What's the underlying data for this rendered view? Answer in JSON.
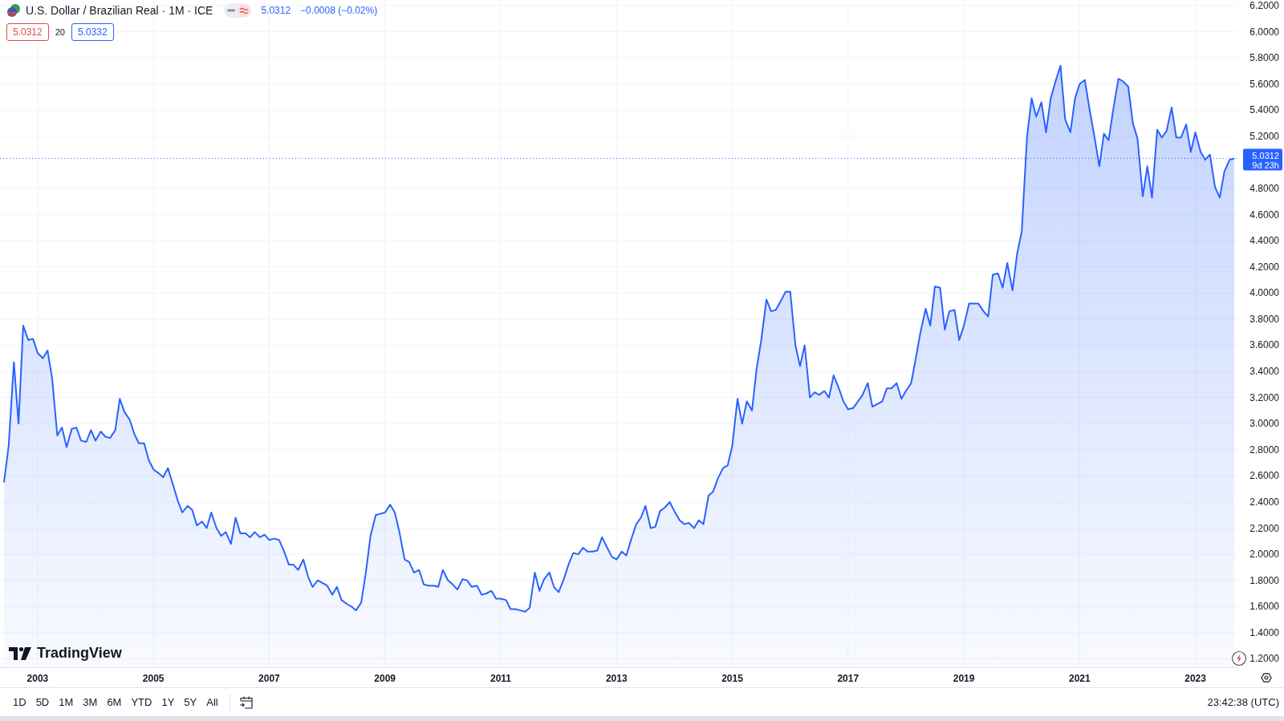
{
  "legend": {
    "title": "U.S. Dollar / Brazilian Real · 1M · ICE",
    "last": "5.0312",
    "change": "−0.0008 (−0.02%)",
    "bid": "5.0312",
    "spread": "20",
    "ask": "5.0332",
    "compare_toggle": {
      "on": true
    }
  },
  "chart": {
    "chart_data": {
      "type": "area",
      "x": [
        2002.42,
        2002.5,
        2002.59,
        2002.67,
        2002.75,
        2002.84,
        2002.92,
        2003,
        2003.09,
        2003.17,
        2003.25,
        2003.34,
        2003.42,
        2003.5,
        2003.59,
        2003.67,
        2003.75,
        2003.84,
        2003.92,
        2004,
        2004.09,
        2004.17,
        2004.25,
        2004.34,
        2004.42,
        2004.5,
        2004.59,
        2004.67,
        2004.75,
        2004.84,
        2004.92,
        2005,
        2005.09,
        2005.17,
        2005.25,
        2005.34,
        2005.42,
        2005.5,
        2005.59,
        2005.67,
        2005.75,
        2005.84,
        2005.92,
        2006,
        2006.09,
        2006.17,
        2006.25,
        2006.34,
        2006.42,
        2006.5,
        2006.59,
        2006.67,
        2006.75,
        2006.84,
        2006.92,
        2007,
        2007.09,
        2007.17,
        2007.25,
        2007.34,
        2007.42,
        2007.5,
        2007.59,
        2007.67,
        2007.75,
        2007.84,
        2007.92,
        2008,
        2008.09,
        2008.17,
        2008.25,
        2008.34,
        2008.42,
        2008.5,
        2008.59,
        2008.67,
        2008.75,
        2008.84,
        2008.92,
        2009,
        2009.09,
        2009.17,
        2009.25,
        2009.34,
        2009.42,
        2009.5,
        2009.59,
        2009.67,
        2009.75,
        2009.84,
        2009.92,
        2010,
        2010.09,
        2010.17,
        2010.25,
        2010.34,
        2010.42,
        2010.5,
        2010.59,
        2010.67,
        2010.75,
        2010.84,
        2010.92,
        2011,
        2011.09,
        2011.17,
        2011.25,
        2011.34,
        2011.42,
        2011.5,
        2011.59,
        2011.67,
        2011.75,
        2011.84,
        2011.92,
        2012,
        2012.09,
        2012.17,
        2012.25,
        2012.34,
        2012.42,
        2012.5,
        2012.59,
        2012.67,
        2012.75,
        2012.84,
        2012.92,
        2013,
        2013.09,
        2013.17,
        2013.25,
        2013.34,
        2013.42,
        2013.5,
        2013.59,
        2013.67,
        2013.75,
        2013.84,
        2013.92,
        2014,
        2014.09,
        2014.17,
        2014.25,
        2014.34,
        2014.42,
        2014.5,
        2014.59,
        2014.67,
        2014.75,
        2014.84,
        2014.92,
        2015,
        2015.09,
        2015.17,
        2015.25,
        2015.34,
        2015.42,
        2015.5,
        2015.59,
        2015.67,
        2015.75,
        2015.84,
        2015.92,
        2016,
        2016.09,
        2016.17,
        2016.25,
        2016.34,
        2016.42,
        2016.5,
        2016.59,
        2016.67,
        2016.75,
        2016.84,
        2016.92,
        2017,
        2017.09,
        2017.17,
        2017.25,
        2017.34,
        2017.42,
        2017.5,
        2017.59,
        2017.67,
        2017.75,
        2017.84,
        2017.92,
        2018,
        2018.09,
        2018.17,
        2018.25,
        2018.34,
        2018.42,
        2018.5,
        2018.59,
        2018.67,
        2018.75,
        2018.84,
        2018.92,
        2019,
        2019.09,
        2019.17,
        2019.25,
        2019.34,
        2019.42,
        2019.5,
        2019.59,
        2019.67,
        2019.75,
        2019.84,
        2019.92,
        2020,
        2020.09,
        2020.17,
        2020.25,
        2020.34,
        2020.42,
        2020.5,
        2020.59,
        2020.67,
        2020.75,
        2020.84,
        2020.92,
        2021,
        2021.09,
        2021.17,
        2021.25,
        2021.34,
        2021.42,
        2021.5,
        2021.59,
        2021.67,
        2021.75,
        2021.84,
        2021.92,
        2022,
        2022.09,
        2022.17,
        2022.25,
        2022.34,
        2022.42,
        2022.5,
        2022.59,
        2022.67,
        2022.75,
        2022.84,
        2022.92,
        2023,
        2023.09,
        2023.17,
        2023.25,
        2023.34,
        2023.42,
        2023.5,
        2023.59,
        2023.67
      ],
      "series": [
        {
          "color": "#2962ff",
          "values": [
            2.55,
            2.83,
            3.47,
            3.0,
            3.75,
            3.64,
            3.65,
            3.54,
            3.5,
            3.56,
            3.35,
            2.91,
            2.97,
            2.82,
            2.96,
            2.97,
            2.87,
            2.86,
            2.95,
            2.87,
            2.94,
            2.9,
            2.89,
            2.95,
            3.19,
            3.09,
            3.03,
            2.92,
            2.85,
            2.85,
            2.72,
            2.65,
            2.62,
            2.59,
            2.66,
            2.53,
            2.41,
            2.32,
            2.37,
            2.34,
            2.22,
            2.25,
            2.2,
            2.32,
            2.2,
            2.14,
            2.17,
            2.08,
            2.28,
            2.16,
            2.16,
            2.13,
            2.17,
            2.13,
            2.15,
            2.11,
            2.12,
            2.11,
            2.03,
            1.92,
            1.92,
            1.88,
            1.96,
            1.83,
            1.75,
            1.8,
            1.78,
            1.76,
            1.69,
            1.75,
            1.65,
            1.62,
            1.6,
            1.57,
            1.63,
            1.86,
            2.14,
            2.3,
            2.31,
            2.32,
            2.38,
            2.32,
            2.17,
            1.96,
            1.94,
            1.86,
            1.88,
            1.77,
            1.76,
            1.76,
            1.75,
            1.88,
            1.8,
            1.77,
            1.73,
            1.81,
            1.8,
            1.75,
            1.76,
            1.69,
            1.7,
            1.72,
            1.66,
            1.66,
            1.65,
            1.58,
            1.58,
            1.57,
            1.56,
            1.59,
            1.86,
            1.72,
            1.81,
            1.86,
            1.75,
            1.71,
            1.81,
            1.92,
            2.01,
            2.0,
            2.05,
            2.02,
            2.02,
            2.03,
            2.13,
            2.05,
            1.98,
            1.96,
            2.02,
            1.99,
            2.11,
            2.23,
            2.28,
            2.37,
            2.2,
            2.21,
            2.33,
            2.36,
            2.4,
            2.33,
            2.26,
            2.23,
            2.24,
            2.2,
            2.26,
            2.23,
            2.45,
            2.48,
            2.58,
            2.66,
            2.68,
            2.83,
            3.19,
            3.0,
            3.17,
            3.1,
            3.42,
            3.64,
            3.95,
            3.86,
            3.87,
            3.94,
            4.01,
            4.01,
            3.6,
            3.44,
            3.6,
            3.2,
            3.24,
            3.22,
            3.25,
            3.2,
            3.37,
            3.27,
            3.17,
            3.11,
            3.12,
            3.17,
            3.22,
            3.31,
            3.13,
            3.15,
            3.17,
            3.27,
            3.27,
            3.31,
            3.19,
            3.25,
            3.31,
            3.5,
            3.7,
            3.88,
            3.75,
            4.05,
            4.04,
            3.72,
            3.86,
            3.87,
            3.64,
            3.75,
            3.92,
            3.92,
            3.92,
            3.86,
            3.82,
            4.14,
            4.15,
            4.04,
            4.23,
            4.02,
            4.3,
            4.47,
            5.19,
            5.49,
            5.35,
            5.46,
            5.23,
            5.49,
            5.63,
            5.74,
            5.33,
            5.23,
            5.49,
            5.6,
            5.63,
            5.41,
            5.21,
            4.97,
            5.22,
            5.17,
            5.43,
            5.64,
            5.62,
            5.58,
            5.3,
            5.18,
            4.74,
            4.97,
            4.73,
            5.25,
            5.19,
            5.24,
            5.42,
            5.19,
            5.19,
            5.29,
            5.08,
            5.23,
            5.08,
            5.02,
            5.06,
            4.81,
            4.73,
            4.93,
            5.02,
            5.03
          ]
        }
      ],
      "grid": true,
      "ref_lines": [
        {
          "axis": "y",
          "value": 5.0312,
          "color": "#2962ff"
        }
      ],
      "xlim": [
        2002.35,
        2023.74
      ],
      "ylim": [
        1.135,
        6.243
      ],
      "xticks": [
        2003,
        2005,
        2007,
        2009,
        2011,
        2013,
        2015,
        2017,
        2019,
        2021,
        2023
      ],
      "yticks": [
        {
          "value": 1.2,
          "label": "1.2000"
        },
        {
          "value": 1.4,
          "label": "1.4000"
        },
        {
          "value": 1.6,
          "label": "1.6000"
        },
        {
          "value": 1.8,
          "label": "1.8000"
        },
        {
          "value": 2.0,
          "label": "2.0000"
        },
        {
          "value": 2.2,
          "label": "2.2000"
        },
        {
          "value": 2.4,
          "label": "2.4000"
        },
        {
          "value": 2.6,
          "label": "2.6000"
        },
        {
          "value": 2.8,
          "label": "2.8000"
        },
        {
          "value": 3.0,
          "label": "3.0000"
        },
        {
          "value": 3.2,
          "label": "3.2000"
        },
        {
          "value": 3.4,
          "label": "3.4000"
        },
        {
          "value": 3.6,
          "label": "3.6000"
        },
        {
          "value": 3.8,
          "label": "3.8000"
        },
        {
          "value": 4.0,
          "label": "4.0000"
        },
        {
          "value": 4.2,
          "label": "4.2000"
        },
        {
          "value": 4.4,
          "label": "4.4000"
        },
        {
          "value": 4.6,
          "label": "4.6000"
        },
        {
          "value": 4.8,
          "label": "4.8000"
        },
        {
          "value": 5.2,
          "label": "5.2000"
        },
        {
          "value": 5.4,
          "label": "5.4000"
        },
        {
          "value": 5.6,
          "label": "5.6000"
        },
        {
          "value": 5.8,
          "label": "5.8000"
        },
        {
          "value": 6.0,
          "label": "6.0000"
        },
        {
          "value": 6.2,
          "label": "6.2000"
        }
      ]
    },
    "price_label": {
      "price": "5.0312",
      "countdown": "9d 23h"
    },
    "logo": "TradingView"
  },
  "range_buttons": [
    "1D",
    "5D",
    "1M",
    "3M",
    "6M",
    "YTD",
    "1Y",
    "5Y",
    "All"
  ],
  "clock": "23:42:38 (UTC)"
}
